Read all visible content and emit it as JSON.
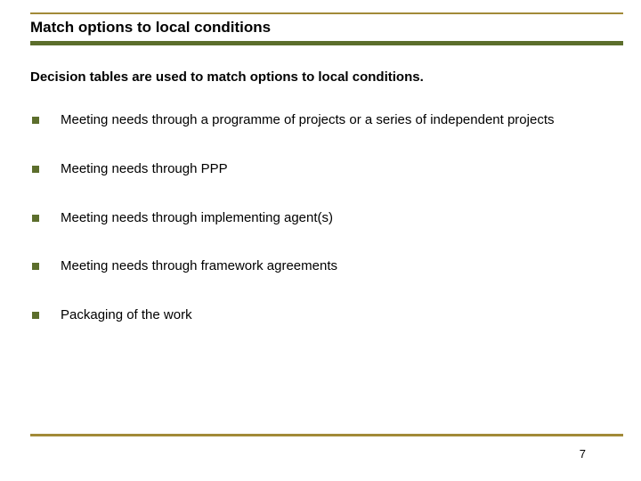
{
  "title": "Match options to local conditions",
  "subtitle": "Decision tables are used to match options to local conditions.",
  "bullets": [
    "Meeting needs through a programme of projects or a series of independent projects",
    "Meeting needs through PPP",
    "Meeting needs through implementing agent(s)",
    "Meeting needs through framework agreements",
    "Packaging of the work"
  ],
  "page_number": "7"
}
